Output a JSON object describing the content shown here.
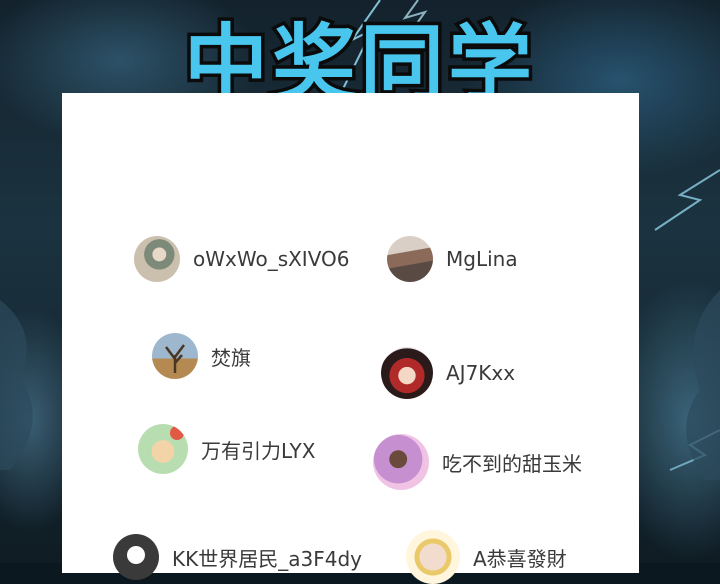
{
  "title": "中奖同学",
  "winners": [
    {
      "name": "oWxWo_sXIVO6",
      "avatar": "photo-avatar"
    },
    {
      "name": "MgLina",
      "avatar": "photo-avatar"
    },
    {
      "name": "焚旗",
      "avatar": "tree-avatar"
    },
    {
      "name": "AJ7Kxx",
      "avatar": "illustrated-girl-avatar"
    },
    {
      "name": "万有引力LYX",
      "avatar": "cartoon-avatar"
    },
    {
      "name": "吃不到的甜玉米",
      "avatar": "cartoon-avatar"
    },
    {
      "name": "KK世界居民_a3F4dy",
      "avatar": "default-avatar"
    },
    {
      "name": "A恭喜發財",
      "avatar": "framed-avatar"
    }
  ],
  "colors": {
    "title_fill": "#48c6ee",
    "title_stroke": "#0b0b0b",
    "card": "#ffffff"
  }
}
